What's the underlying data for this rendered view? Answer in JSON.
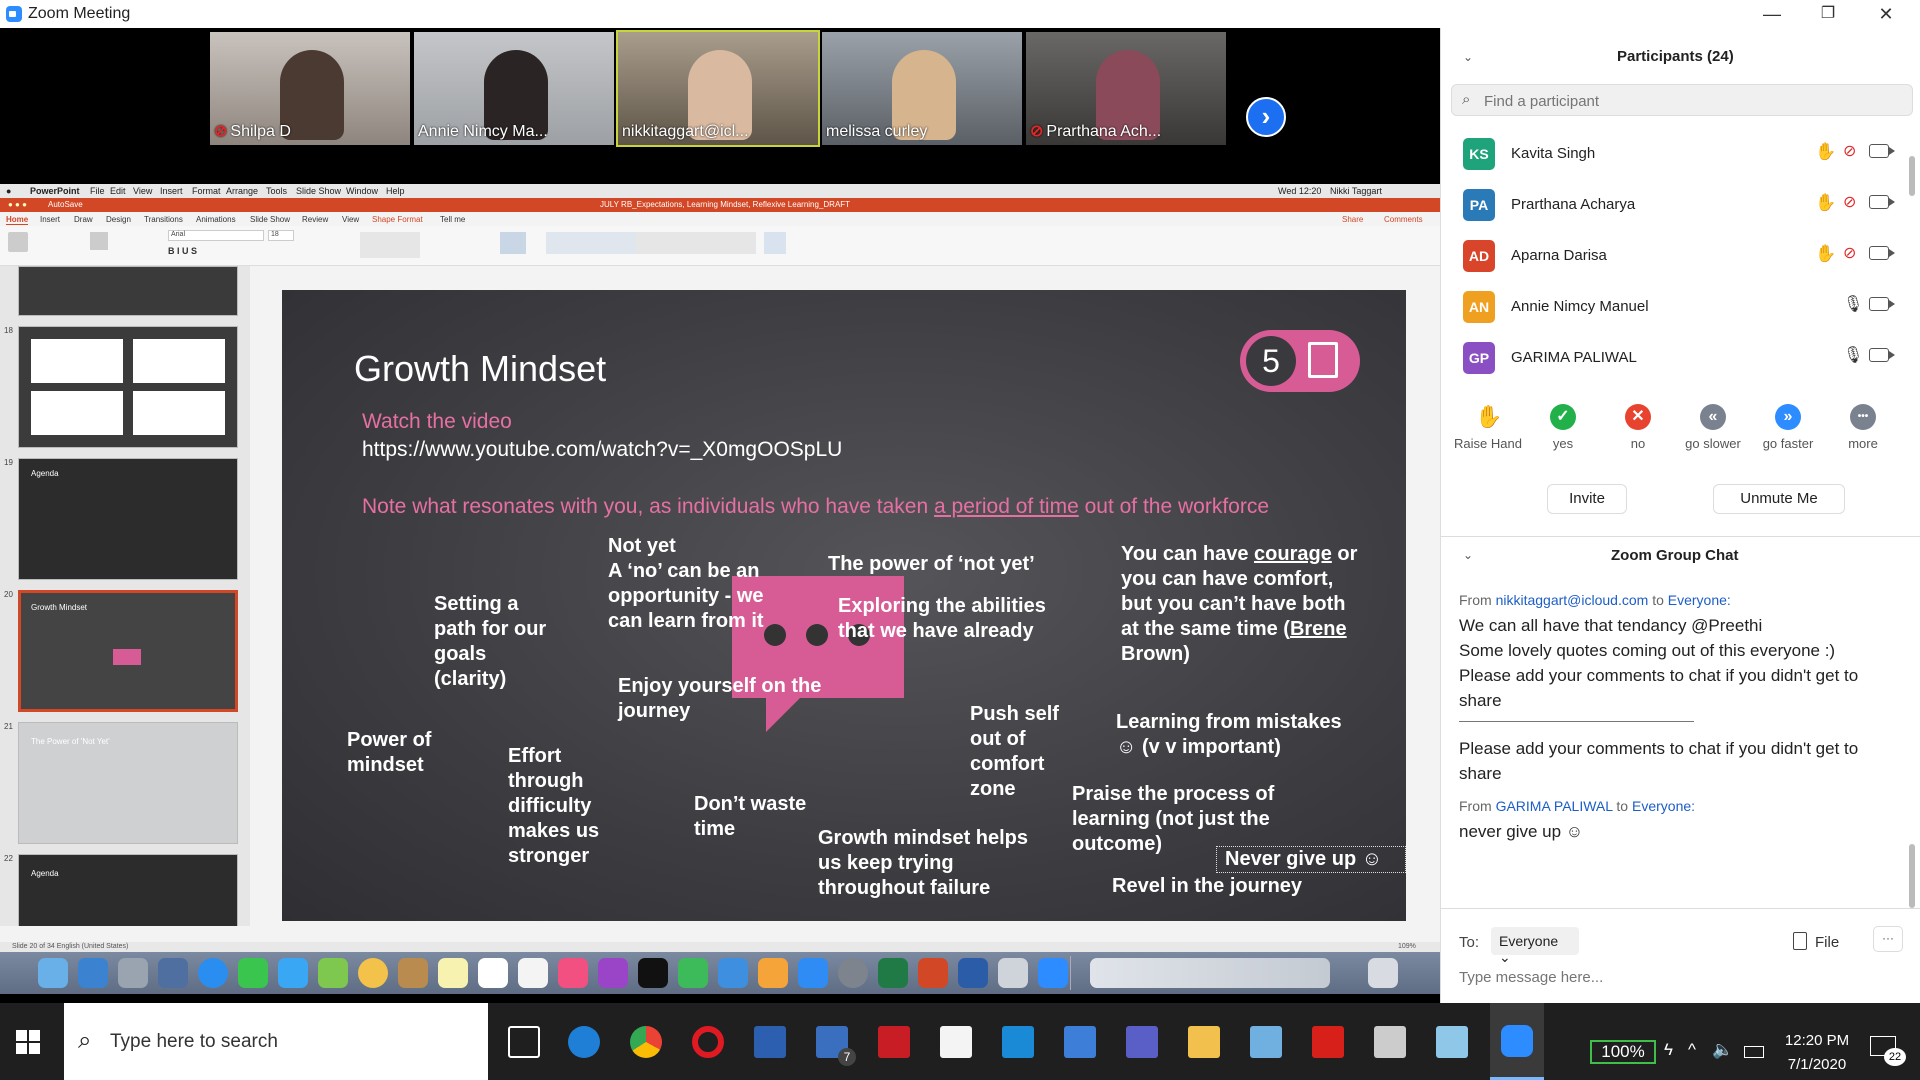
{
  "window": {
    "title": "Zoom Meeting",
    "minimize": "—",
    "maximize": "❐",
    "close": "✕"
  },
  "videos": [
    {
      "name": "Shilpa D",
      "muted": true
    },
    {
      "name": "Annie Nimcy Ma...",
      "muted": false
    },
    {
      "name": "nikkitaggart@icl...",
      "muted": false
    },
    {
      "name": "melissa curley",
      "muted": false
    },
    {
      "name": "Prarthana Ach...",
      "muted": true
    }
  ],
  "next_arrow": "›",
  "mac_menu": {
    "app": "PowerPoint",
    "items": [
      "File",
      "Edit",
      "View",
      "Insert",
      "Format",
      "Arrange",
      "Tools",
      "Slide Show",
      "Window",
      "Help"
    ],
    "clock": "Wed 12:20",
    "user": "Nikki Taggart"
  },
  "ppt": {
    "doc_title": "JULY RB_Expectations, Learning Mindset, Reflexive Learning_DRAFT",
    "autosave": "AutoSave",
    "tabs": [
      "Home",
      "Insert",
      "Draw",
      "Design",
      "Transitions",
      "Animations",
      "Slide Show",
      "Review",
      "View",
      "Shape Format",
      "Tell me"
    ],
    "share": "Share",
    "comments": "Comments",
    "font": "Arial",
    "font_size": "18",
    "status": "Slide 20 of 34    English (United States)",
    "zoom": "109%",
    "slide_numbers": [
      "18",
      "19",
      "20",
      "21",
      "22"
    ],
    "thumb_texts": {
      "agenda": "Agenda",
      "growth": "Growth Mindset",
      "notyet": "The Power of 'Not Yet'"
    }
  },
  "slide": {
    "title": "Growth Mindset",
    "badge_number": "5",
    "watch": "Watch the video",
    "url": "https://www.youtube.com/watch?v=_X0mgOOSpLU",
    "note_before": "Note what resonates with you, as individuals who have taken ",
    "note_link": "a period of time",
    "note_after": " out of the workforce",
    "quotes": {
      "not_yet": "Not yet\nA ‘no’ can be an opportunity - we can learn from it",
      "power_not_yet": "The power of ‘not yet’",
      "courage_before": "You can have ",
      "courage_word": "courage",
      "courage_after": " or you can have comfort, but you can’t have both at the same time (",
      "brene": "Brene",
      "brown": " Brown)",
      "path": "Setting a path for our goals (clarity)",
      "exploring": "Exploring the abilities that we have already",
      "enjoy": "Enjoy yourself on the journey",
      "push": "Push self out of comfort zone",
      "mistakes": "Learning from mistakes ☺ (v v important)",
      "power_mindset": "Power of mindset",
      "effort": "Effort through difficulty makes us stronger",
      "dont_waste": "Don’t waste time",
      "praise": "Praise the process of learning (not just the outcome)",
      "never": "Never give up ☺",
      "helps": "Growth mindset helps us keep trying throughout failure",
      "revel": "Revel in the journey"
    }
  },
  "participants": {
    "title": "Participants (24)",
    "search_placeholder": "Find a participant",
    "list": [
      {
        "initials": "KS",
        "name": "Kavita Singh",
        "color": "#1fa37a",
        "hand": true,
        "muted": true
      },
      {
        "initials": "PA",
        "name": "Prarthana Acharya",
        "color": "#2a7ab8",
        "hand": true,
        "muted": true
      },
      {
        "initials": "AD",
        "name": "Aparna Darisa",
        "color": "#d9452b",
        "hand": true,
        "muted": true
      },
      {
        "initials": "AN",
        "name": "Annie Nimcy Manuel",
        "color": "#f0a020",
        "hand": false,
        "muted": false
      },
      {
        "initials": "GP",
        "name": "GARIMA PALIWAL",
        "color": "#8a4fc2",
        "hand": false,
        "muted": false
      }
    ],
    "feedback": [
      {
        "label": "Raise Hand",
        "symbol": "✋",
        "color": "#2d6ff2"
      },
      {
        "label": "yes",
        "symbol": "✓",
        "color": "#22b04b"
      },
      {
        "label": "no",
        "symbol": "✕",
        "color": "#e8432f"
      },
      {
        "label": "go slower",
        "symbol": "«",
        "color": "#7a8290"
      },
      {
        "label": "go faster",
        "symbol": "»",
        "color": "#2d8cff"
      },
      {
        "label": "more",
        "symbol": "•••",
        "color": "#7a8290"
      }
    ],
    "invite": "Invite",
    "unmute_me": "Unmute Me"
  },
  "chat": {
    "title": "Zoom Group Chat",
    "from_label": "From",
    "to_label": "to",
    "msg1_from": "nikkitaggart@icloud.com",
    "msg1_to": "Everyone:",
    "msg1_lines": [
      "We can all have that tendancy @Preethi",
      "Some lovely quotes coming out of this everyone :)",
      "Please add your comments to chat if you didn't get to share"
    ],
    "msg1_last": "Please add your comments to chat if you didn't get to share",
    "msg2_from": "GARIMA PALIWAL",
    "msg2_to": "Everyone:",
    "msg2_text": "never give up ☺",
    "to_field_label": "To:",
    "recipient": "Everyone",
    "file": "File",
    "input_placeholder": "Type message here..."
  },
  "taskbar": {
    "search_placeholder": "Type here to search",
    "battery": "100%",
    "time": "12:20 PM",
    "date": "7/1/2020",
    "notifications": "22",
    "mail_badge": "7"
  }
}
